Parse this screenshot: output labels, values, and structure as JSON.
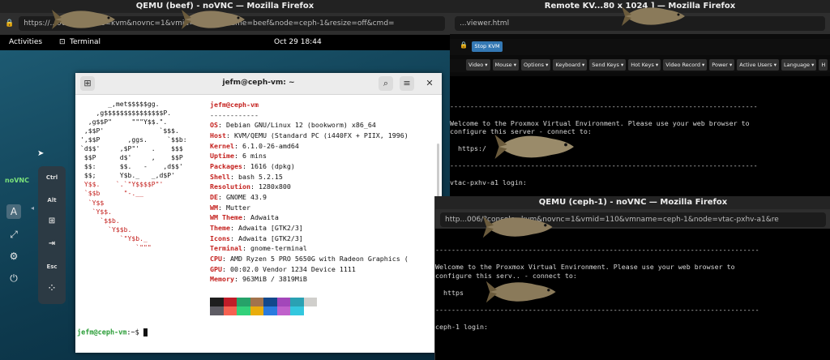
{
  "win_beef": {
    "title": "QEMU (beef) - noVNC — Mozilla Firefox",
    "url": "https://...006/?console=kvm&novnc=1&vmid=100&vmname=beef&node=ceph-1&resize=off&cmd="
  },
  "gnome": {
    "activities": "Activities",
    "terminal_app": "Terminal",
    "clock": "Oct 29  18:44"
  },
  "novnc_side": {
    "logo": "noVNC",
    "keys": [
      "Ctrl",
      "Alt",
      "Esc"
    ]
  },
  "terminal": {
    "title": "jefm@ceph-vm: ~",
    "ascii": [
      "       _,met$$$$$gg.",
      "    ,g$$$$$$$$$$$$$$$P.",
      "  ,g$$P\"     \"\"\"Y$$.\".",
      " ,$$P'              `$$$.",
      "',$$P       ,ggs.     `$$b:",
      "`d$$'     ,$P\"'   .    $$$",
      " $$P      d$'     ,    $$P",
      " $$:      $$.   -    ,d$$'",
      " $$;      Y$b._   _,d$P'",
      " Y$$.    `.`\"Y$$$$P\"'",
      " `$$b      \"-.__",
      "  `Y$$",
      "   `Y$$.",
      "     `$$b.",
      "       `Y$$b.",
      "          `\"Y$b._",
      "              `\"\"\""
    ],
    "user_host": "jefm@ceph-vm",
    "separator": "------------",
    "info": [
      {
        "k": "OS",
        "v": "Debian GNU/Linux 12 (bookworm) x86_64"
      },
      {
        "k": "Host",
        "v": "KVM/QEMU (Standard PC (i440FX + PIIX, 1996)"
      },
      {
        "k": "Kernel",
        "v": "6.1.0-26-amd64"
      },
      {
        "k": "Uptime",
        "v": "6 mins"
      },
      {
        "k": "Packages",
        "v": "1616 (dpkg)"
      },
      {
        "k": "Shell",
        "v": "bash 5.2.15"
      },
      {
        "k": "Resolution",
        "v": "1280x800"
      },
      {
        "k": "DE",
        "v": "GNOME 43.9"
      },
      {
        "k": "WM",
        "v": "Mutter"
      },
      {
        "k": "WM Theme",
        "v": "Adwaita"
      },
      {
        "k": "Theme",
        "v": "Adwaita [GTK2/3]"
      },
      {
        "k": "Icons",
        "v": "Adwaita [GTK2/3]"
      },
      {
        "k": "Terminal",
        "v": "gnome-terminal"
      },
      {
        "k": "CPU",
        "v": "AMD Ryzen 5 PRO 5650G with Radeon Graphics ("
      },
      {
        "k": "GPU",
        "v": "00:02.0 Vendor 1234 Device 1111"
      },
      {
        "k": "Memory",
        "v": "963MiB / 3819MiB"
      }
    ],
    "palette_top": [
      "#1e1e1e",
      "#c01c28",
      "#26a269",
      "#a2734c",
      "#12488b",
      "#a347ba",
      "#2aa1b3",
      "#d0cfcc"
    ],
    "palette_bottom": [
      "#5e5c64",
      "#f66151",
      "#33d17a",
      "#e9ad0c",
      "#2a7bde",
      "#c061cb",
      "#33c7de",
      "#ffffff"
    ],
    "prompt_user": "jefm@ceph-vm",
    "prompt_rest": ":~$ "
  },
  "win_remote": {
    "title": "Remote KV...80 x 1024 ] — Mozilla Firefox",
    "url": "...viewer.html",
    "stop_kvm": "Stop KVM",
    "menus": [
      "Video ▾",
      "Mouse ▾",
      "Options ▾",
      "Keyboard ▾",
      "Send Keys ▾",
      "Hot Keys ▾",
      "Video Record ▾",
      "Power ▾",
      "Active Users ▾",
      "Language ▾",
      "H"
    ],
    "console_lines": [
      "",
      "",
      "",
      "----------------------------------------------------------------------------",
      "",
      "Welcome to the Proxmox Virtual Environment. Please use your web browser to",
      "configure this server - connect to:",
      "",
      "  https:/",
      "",
      "----------------------------------------------------------------------------",
      "",
      "vtac-pxhv-a1 login:"
    ]
  },
  "win_ceph": {
    "title": "QEMU (ceph-1) - noVNC — Mozilla Firefox",
    "url": "http...006/?console=kvm&novnc=1&vmid=110&vmname=ceph-1&node=vtac-pxhv-a1&re",
    "console_lines": [
      "",
      "",
      "--------------------------------------------------------------------------------",
      "",
      "Welcome to the Proxmox Virtual Environment. Please use your web browser to",
      "configure this serv.. - connect to:",
      "",
      "  https",
      "",
      "--------------------------------------------------------------------------------",
      "",
      "ceph-1 login:"
    ]
  }
}
